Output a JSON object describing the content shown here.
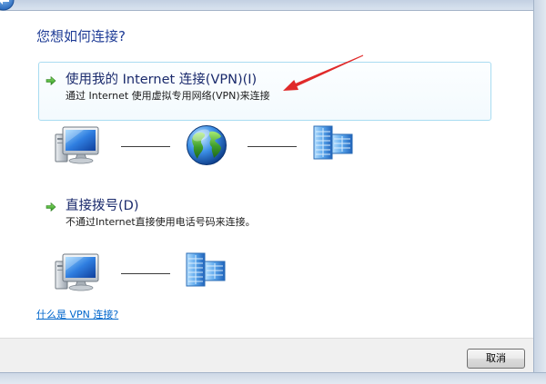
{
  "window": {
    "back_icon": "back-arrow-icon"
  },
  "dialog": {
    "heading": "您想如何连接?",
    "options": [
      {
        "icon": "green-arrow-icon",
        "title": "使用我的 Internet 连接(VPN)(I)",
        "description": "通过 Internet 使用虚拟专用网络(VPN)来连接",
        "highlighted": true,
        "diagram": [
          "computer-icon",
          "internet-globe-icon",
          "workplace-network-icon"
        ]
      },
      {
        "icon": "green-arrow-icon",
        "title": "直接拨号(D)",
        "description": "不通过Internet直接使用电话号码来连接。",
        "highlighted": false,
        "diagram": [
          "computer-icon",
          "workplace-network-icon"
        ]
      }
    ],
    "help_link": "什么是 VPN 连接?"
  },
  "footer": {
    "cancel_label": "取消"
  },
  "annotation": {
    "icon": "red-arrow-icon"
  },
  "colors": {
    "heading": "#1f3c96",
    "option_title": "#1a2a6c",
    "link": "#0066cc",
    "highlight_border": "#a9dcf1",
    "annotation": "#e02a2a",
    "command_area": "#f0f0f0"
  }
}
